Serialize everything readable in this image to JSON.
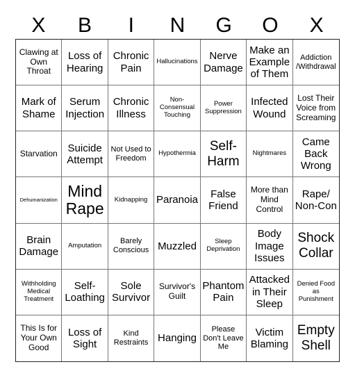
{
  "header": [
    "X",
    "B",
    "I",
    "N",
    "G",
    "O",
    "X"
  ],
  "cells": [
    {
      "text": "Clawing at Own Throat",
      "size": "s-m"
    },
    {
      "text": "Loss of Hearing",
      "size": "s-l"
    },
    {
      "text": "Chronic Pain",
      "size": "s-l"
    },
    {
      "text": "Hallucinations",
      "size": "s-s"
    },
    {
      "text": "Nerve Damage",
      "size": "s-l"
    },
    {
      "text": "Make an Example of Them",
      "size": "s-l"
    },
    {
      "text": "Addiction /Withdrawal",
      "size": "s-sm"
    },
    {
      "text": "Mark of Shame",
      "size": "s-l"
    },
    {
      "text": "Serum Injection",
      "size": "s-l"
    },
    {
      "text": "Chronic Illness",
      "size": "s-l"
    },
    {
      "text": "Non-Consensual Touching",
      "size": "s-s"
    },
    {
      "text": "Power Suppression",
      "size": "s-s"
    },
    {
      "text": "Infected Wound",
      "size": "s-l"
    },
    {
      "text": "Lost Their Voice from Screaming",
      "size": "s-m"
    },
    {
      "text": "Starvation",
      "size": "s-m"
    },
    {
      "text": "Suicide Attempt",
      "size": "s-l"
    },
    {
      "text": "Not Used to Freedom",
      "size": "s-sm"
    },
    {
      "text": "Hypothermia",
      "size": "s-s"
    },
    {
      "text": "Self-Harm",
      "size": "s-xl"
    },
    {
      "text": "Nightmares",
      "size": "s-s"
    },
    {
      "text": "Came Back Wrong",
      "size": "s-l"
    },
    {
      "text": "Dehumanization",
      "size": "s-xs"
    },
    {
      "text": "Mind Rape",
      "size": "s-xxl"
    },
    {
      "text": "Kidnapping",
      "size": "s-s"
    },
    {
      "text": "Paranoia",
      "size": "s-l"
    },
    {
      "text": "False Friend",
      "size": "s-l"
    },
    {
      "text": "More than Mind Control",
      "size": "s-m"
    },
    {
      "text": "Rape/ Non-Con",
      "size": "s-l"
    },
    {
      "text": "Brain Damage",
      "size": "s-l"
    },
    {
      "text": "Amputation",
      "size": "s-s"
    },
    {
      "text": "Barely Conscious",
      "size": "s-sm"
    },
    {
      "text": "Muzzled",
      "size": "s-l"
    },
    {
      "text": "Sleep Deprivation",
      "size": "s-s"
    },
    {
      "text": "Body Image Issues",
      "size": "s-l"
    },
    {
      "text": "Shock Collar",
      "size": "s-xl"
    },
    {
      "text": "Withholding Medical Treatment",
      "size": "s-s"
    },
    {
      "text": "Self-Loathing",
      "size": "s-l"
    },
    {
      "text": "Sole Survivor",
      "size": "s-l"
    },
    {
      "text": "Survivor's Guilt",
      "size": "s-m"
    },
    {
      "text": "Phantom Pain",
      "size": "s-l"
    },
    {
      "text": "Attacked in Their Sleep",
      "size": "s-l"
    },
    {
      "text": "Denied Food as Punishment",
      "size": "s-s"
    },
    {
      "text": "This Is for Your Own Good",
      "size": "s-m"
    },
    {
      "text": "Loss of Sight",
      "size": "s-l"
    },
    {
      "text": "Kind Restraints",
      "size": "s-sm"
    },
    {
      "text": "Hanging",
      "size": "s-l"
    },
    {
      "text": "Please Don't Leave Me",
      "size": "s-sm"
    },
    {
      "text": "Victim Blaming",
      "size": "s-l"
    },
    {
      "text": "Empty Shell",
      "size": "s-xl"
    }
  ]
}
